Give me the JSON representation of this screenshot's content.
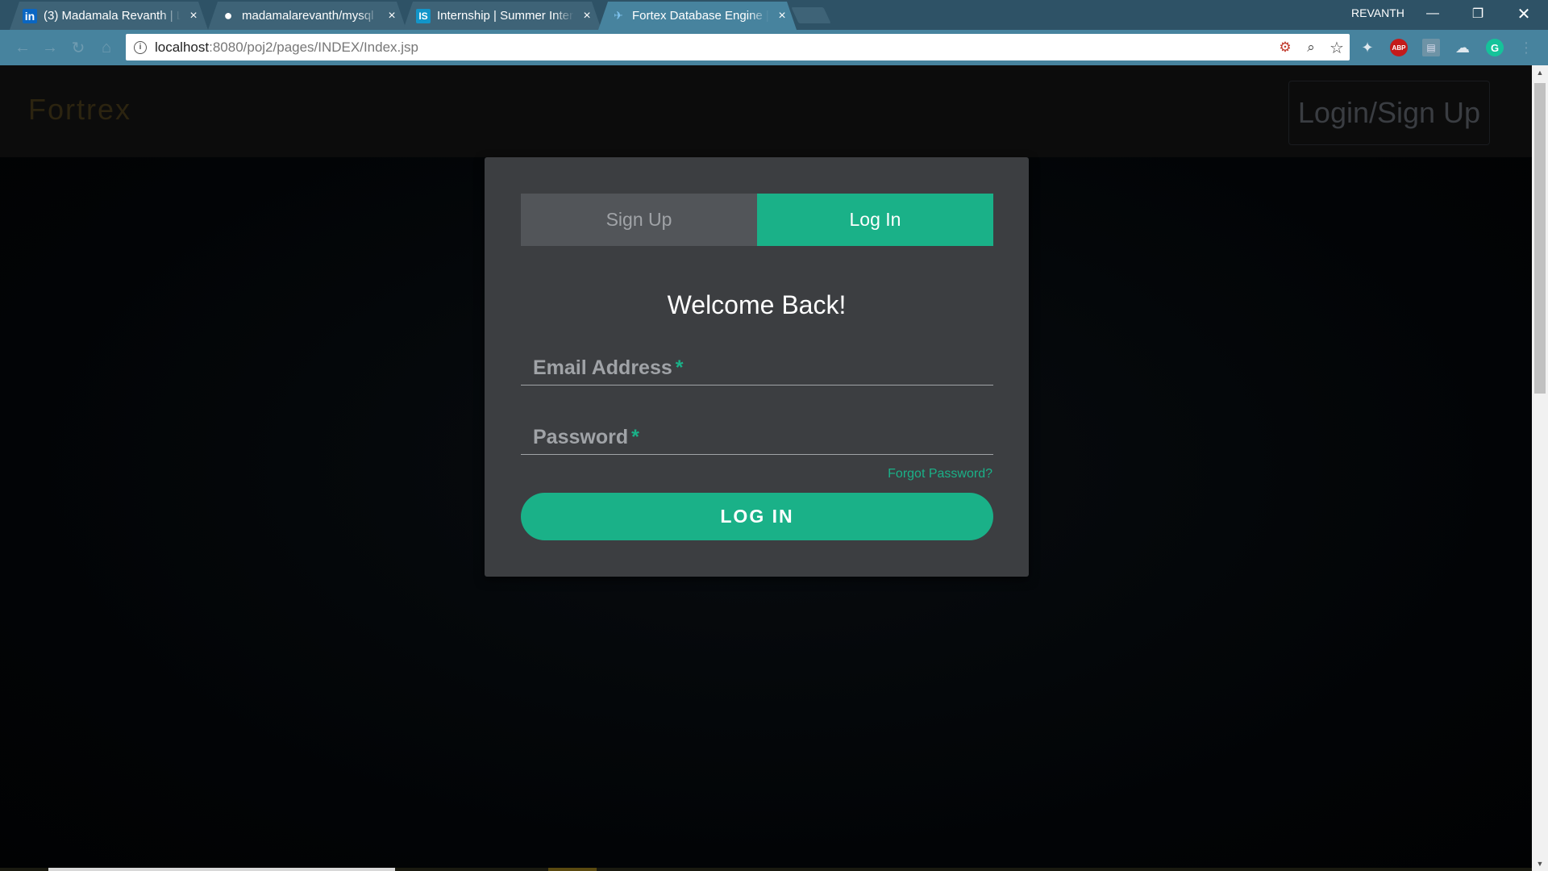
{
  "browser": {
    "tabs": [
      {
        "favicon": "linkedin-icon",
        "favicon_text": "in",
        "title": "(3) Madamala Revanth | L"
      },
      {
        "favicon": "github-icon",
        "favicon_text": "●",
        "title": "madamalarevanth/mysql"
      },
      {
        "favicon": "internshala-icon",
        "favicon_text": "IS",
        "title": "Internship | Summer Inter"
      },
      {
        "favicon": "fortrex-icon",
        "favicon_text": "✈",
        "title": "Fortex Database Engine |"
      }
    ],
    "close_glyph": "×",
    "profile_name": "REVANTH",
    "address_host": "localhost",
    "address_path": ":8080/poj2/pages/INDEX/Index.jsp"
  },
  "site": {
    "brand": "Fortrex",
    "header_link": "Login/Sign Up"
  },
  "form": {
    "tab_signup": "Sign Up",
    "tab_login": "Log In",
    "heading": "Welcome Back!",
    "email_label": "Email Address",
    "password_label": "Password",
    "required_mark": "*",
    "forgot_link": "Forgot Password?",
    "submit_label": "LOG IN"
  },
  "colors": {
    "accent": "#1ab188",
    "card": "#3c3e41",
    "tab_inactive": "#525559"
  }
}
